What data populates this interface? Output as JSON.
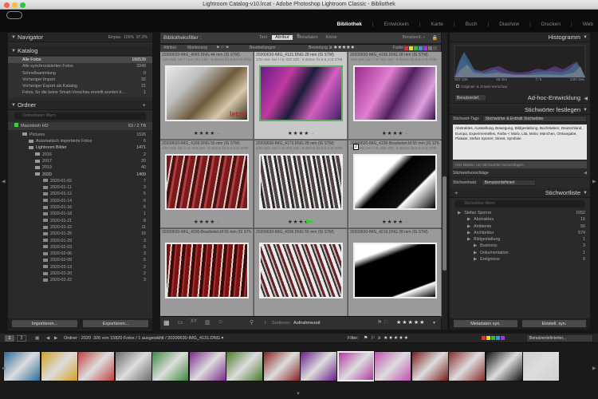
{
  "window": {
    "title": "Lightroom Catalog-v10.lrcat - Adobe Photoshop Lightroom Classic - Bibliothek"
  },
  "modules": [
    {
      "label": "Bibliothek",
      "active": true
    },
    {
      "label": "Entwickeln"
    },
    {
      "label": "Karte"
    },
    {
      "label": "Buch"
    },
    {
      "label": "Diashow"
    },
    {
      "label": "Drucken"
    },
    {
      "label": "Web"
    }
  ],
  "navigator": {
    "title": "Navigator",
    "zoom": [
      "Einpas.",
      "100%",
      "97.2%"
    ]
  },
  "catalog": {
    "title": "Katalog",
    "items": [
      {
        "label": "Alle Fotos",
        "count": "166539"
      },
      {
        "label": "Alle synchronisierten Fotos",
        "count": "3349"
      },
      {
        "label": "Schnellsammlung",
        "count": "0"
      },
      {
        "label": "Vorheriger Import",
        "count": "32"
      },
      {
        "label": "Vorheriger Export als Katalog",
        "count": "21"
      },
      {
        "label": "Fotos, für die keine Smart-Vorschau erstellt wurden k…",
        "count": "1"
      }
    ]
  },
  "folders": {
    "title": "Ordner",
    "filter_placeholder": "Ordnerdaten filtern",
    "volume": {
      "label": "Macintosh HD",
      "count": "63 / 2 TB"
    },
    "tree": [
      {
        "label": "Pictures",
        "count": "1526"
      },
      {
        "label": "Automatisch importierte Fotos",
        "count": "6"
      },
      {
        "label": "Lightroom Bilder",
        "count": "1471"
      },
      {
        "label": "2016",
        "count": "2"
      },
      {
        "label": "2017",
        "count": "20"
      },
      {
        "label": "2019",
        "count": "40"
      },
      {
        "label": "2020",
        "count": "1409"
      }
    ],
    "months": [
      {
        "label": "2020-01-02",
        "count": "7"
      },
      {
        "label": "2020-01-11",
        "count": "3"
      },
      {
        "label": "2020-01-12",
        "count": "5"
      },
      {
        "label": "2020-01-14",
        "count": "6"
      },
      {
        "label": "2020-01-16",
        "count": "5"
      },
      {
        "label": "2020-01-18",
        "count": "1"
      },
      {
        "label": "2020-01-21",
        "count": "8"
      },
      {
        "label": "2020-01-22",
        "count": "11"
      },
      {
        "label": "2020-01-25",
        "count": "15"
      },
      {
        "label": "2020-01-29",
        "count": "3"
      },
      {
        "label": "2020-02-03",
        "count": "5"
      },
      {
        "label": "2020-02-06",
        "count": "3"
      },
      {
        "label": "2020-02-09",
        "count": "5"
      },
      {
        "label": "2020-02-13",
        "count": "2"
      },
      {
        "label": "2020-02-20",
        "count": "2"
      },
      {
        "label": "2020-02-22",
        "count": "3"
      }
    ]
  },
  "left_buttons": {
    "import": "Importieren...",
    "export": "Exportieren..."
  },
  "filterbar": {
    "title": "Bibliotheksfilter :",
    "tabs": [
      "Text",
      "Attribut",
      "Metadaten",
      "Keine"
    ],
    "active_tab": "Attribut",
    "preset": "Benutzerd. ÷",
    "row": {
      "attribut": "Attribut",
      "markierung": "Markierung",
      "bearbeitungen": "Bearbeitungen",
      "bewertung": "Bewertung",
      "farbe": "Farbe"
    }
  },
  "grid": {
    "cells": [
      {
        "name": "20200630-IMG_4065.DNG",
        "lens": "44 mm",
        "badge": "IS STM",
        "exif": "1/20 Sek. bei f / 5,6; ISO 100 ; 5-45mm f/3.5-6.3 IS STM",
        "stars": "★★★★ ·",
        "selected": false
      },
      {
        "name": "20200630-IMG_4131.DNG",
        "lens": "28 mm",
        "badge": "IS STM",
        "exif": "1/20 Sek. bei f / 6; ISO 100 ; 5-45mm f/3.5-6.3 IS STM",
        "stars": "★★★★ ·",
        "selected": true
      },
      {
        "name": "20200630-IMG_4156.DNG",
        "lens": "28 mm",
        "badge": "IS STM",
        "exif": "1/20 Sek. bei f / 6; ISO 100 ; 5-45mm f/3.5-6.3 IS STM",
        "stars": "★★★★ ·",
        "selected": false
      },
      {
        "name": "20200630-IMG_4169.DNG",
        "lens": "55 mm",
        "badge": "IS STM",
        "exif": "1/20 Sek. bei f / 6; ISO 100 ; 5-45mm f/3.5-6.3 IS STM",
        "stars": "★★★★ ·",
        "selected": false
      },
      {
        "name": "20200630-IMG_4173.DNG",
        "lens": "28 mm",
        "badge": "IS STM",
        "exif": "1/20 Sek. bei f / 6; ISO 100 ; 5-45mm f/3.5-6.3 IS STM",
        "stars": "★★★★ ·",
        "selected": false
      },
      {
        "name": "20200630-IMG_4190-Bearbeitet.tif",
        "lens": "55 mm",
        "badge": "IS STM",
        "exif": "1/20 Sek. bei f / 6; ISO 100 ; 5-45mm f/3.5-6.3 IS STM",
        "stars": "★★★★ ·",
        "selected": false
      },
      {
        "name": "20200630-IMG_4200-Bearbeitet.tif",
        "lens": "55 mm",
        "badge": "IS STM",
        "exif": "",
        "stars": "",
        "selected": false
      },
      {
        "name": "20200630-IMG_4206.DNG",
        "lens": "55 mm",
        "badge": "IS STM",
        "exif": "",
        "stars": "",
        "selected": false
      },
      {
        "name": "20200630-IMG_4216.DNG",
        "lens": "28 mm",
        "badge": "IS STM",
        "exif": "",
        "stars": "",
        "selected": false
      }
    ]
  },
  "toolbar": {
    "sort_label": "Sortieren:",
    "sort_value": "Aufnahmezeit"
  },
  "histogram": {
    "title": "Histogramm",
    "iso": "ISO 100",
    "lens": "28 mm",
    "aperture": "f / 6",
    "shutter": "1/20 Sek.",
    "preview": "Original- & Smart-Vorschau"
  },
  "adhoc": {
    "title": "Ad-hoc-Entwicklung",
    "preset": "Benutzerdef."
  },
  "keywords": {
    "title": "Stichwörter festlegen",
    "tag_label": "Stichwort-Tags",
    "tag_value": "Stichwörter & Enthält Stichwörter",
    "text": "Abstraktes, Ausstellung, Bewegung, Bildgestaltung, Buchstaben, Deutschland, Europa, Experimentelles, Farbe < Motiv, Lila, Motiv, München, Ortsangabe, Plakate, Stefan Sporrer, Street, Symbole",
    "hint": "Hier klicken, um Stichwörter hinzuzufügen",
    "suggest": "Stichwortvorschläge",
    "set_label": "Stichwortsatz",
    "set_value": "Benutzerdefiniert"
  },
  "keywordlist": {
    "title": "Stichwortliste",
    "filter_placeholder": "Stichwörter filtern",
    "items": [
      {
        "label": "Stefan Sporrer",
        "count": "1052"
      },
      {
        "label": "Abstraktes",
        "count": "16"
      },
      {
        "label": "Ambiente",
        "count": "56"
      },
      {
        "label": "Architektur",
        "count": "574"
      },
      {
        "label": "Bildgestaltung",
        "count": "1"
      },
      {
        "label": "Business",
        "count": "3"
      },
      {
        "label": "Dokumentation",
        "count": "1"
      },
      {
        "label": "Ereignisse",
        "count": "0"
      }
    ]
  },
  "right_buttons": {
    "sync_meta": "Metadaten syn.",
    "settings_sync": "Einstell. syn."
  },
  "statusbar": {
    "pages": [
      "1",
      "2"
    ],
    "path": "Ordner : 2020",
    "count": "326 von 15820 Fotos /",
    "selected": "1 ausgewählt /",
    "file": "20200630-IMG_4131.DNG ▾",
    "filter_label": "Filter:",
    "custom": "Benutzerdefinierter..."
  }
}
